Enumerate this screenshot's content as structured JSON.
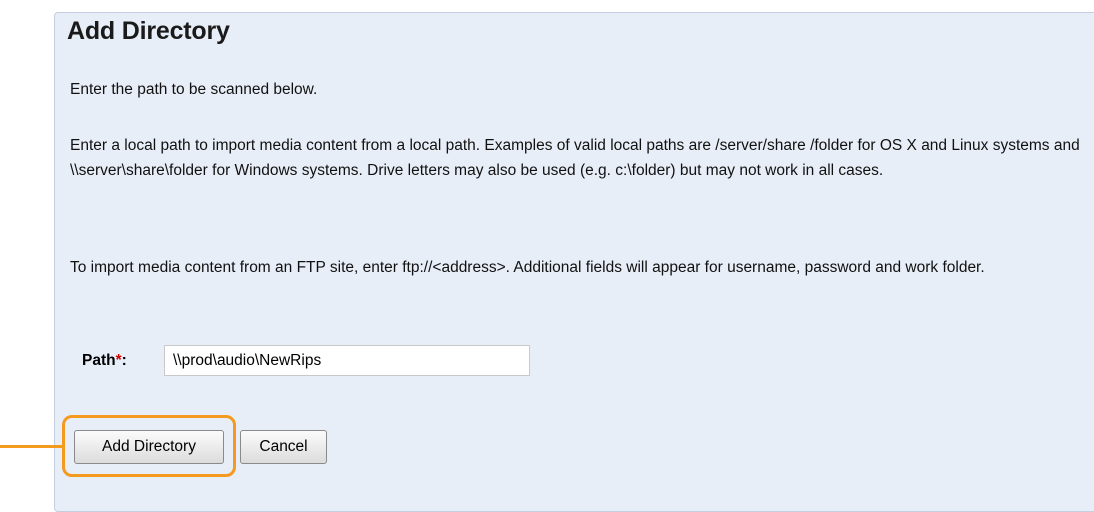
{
  "dialog": {
    "title": "Add Directory",
    "paragraph1": "Enter the path to be scanned below.",
    "paragraph2": "Enter a local path to import media content from a local path. Examples of valid local paths are /server/share /folder for OS X and Linux systems and \\\\server\\share\\folder for Windows systems. Drive letters may also be used (e.g. c:\\folder) but may not work in all cases.",
    "paragraph3": "To import media content from an FTP site, enter ftp://<address>. Additional fields will appear for username, password and work folder."
  },
  "form": {
    "path_label": "Path",
    "required_marker": "*",
    "colon": ":",
    "path_value": "\\\\prod\\audio\\NewRips"
  },
  "buttons": {
    "add_label": "Add Directory",
    "cancel_label": "Cancel"
  },
  "colors": {
    "panel_background": "#e8eef7",
    "highlight": "#f39a1f",
    "required": "#d00000"
  }
}
